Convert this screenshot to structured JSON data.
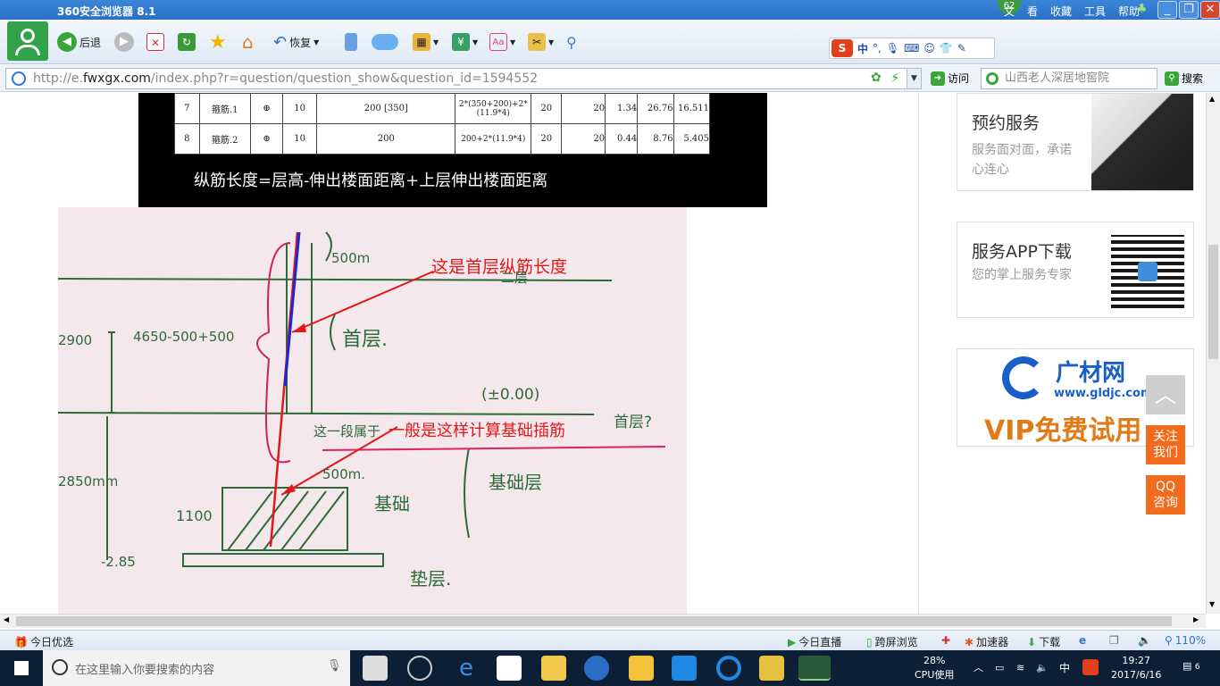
{
  "window": {
    "title": "360安全浏览器 8.1",
    "menu": [
      "文",
      "看",
      "收藏",
      "工具",
      "帮助"
    ],
    "badge": "62",
    "controls": [
      "_",
      "❐",
      "✕"
    ]
  },
  "toolbar": {
    "back_label": "后退",
    "restore_label": "恢复",
    "ime": {
      "logo": "S",
      "lang": "中"
    }
  },
  "address": {
    "url_prefix": "http://e.",
    "url_host": "fwxgx.com",
    "url_rest": "/index.php?r=question/question_show&question_id=1594552",
    "visit_label": "访问",
    "search_placeholder": "山西老人深居地窖院",
    "search_label": "搜索"
  },
  "table_image": {
    "rows": [
      {
        "no": "7",
        "name": "箍筋.1",
        "grade": "⊕",
        "dia": "10",
        "shape": "200 [350]",
        "formula": "2*(350+200)+2*(11.9*4)",
        "c1": "20",
        "c2": "20",
        "w": "1.34",
        "total": "26.76",
        "sum": "16.511"
      },
      {
        "no": "8",
        "name": "箍筋.2",
        "grade": "⊕",
        "dia": "10",
        "shape": "200",
        "formula": "200+2*(11.9*4)",
        "c1": "20",
        "c2": "20",
        "w": "0.44",
        "total": "8.76",
        "sum": "5.405"
      }
    ],
    "caption": "纵筋长度=层高-伸出楼面距离+上层伸出楼面距离"
  },
  "sketch": {
    "annotation_1": "这是首层纵筋长度",
    "annotation_2": "一般是这样计算基础插筋",
    "hand_labels": [
      "500m",
      "二层",
      "2900",
      "4650-500+500",
      "首层.",
      "(±0.00)",
      "这一段属于",
      "首层?",
      "2850mm",
      "500m.",
      "基础层",
      "1100",
      "基础",
      "-2.85",
      "垫层."
    ]
  },
  "sidebar": {
    "card1": {
      "title": "预约服务",
      "sub": "服务面对面，承诺心连心"
    },
    "card2": {
      "title": "服务APP下载",
      "sub": "您的掌上服务专家"
    },
    "card3": {
      "logo": "广材网",
      "domain": "www.gldjc.com",
      "promo": "VIP免费试用"
    },
    "float_top": "︿",
    "float_follow": "关注我们",
    "float_qq": "QQ咨询"
  },
  "status": {
    "today": "今日优选",
    "live": "今日直播",
    "cross": "跨屏浏览",
    "accel": "加速器",
    "download": "下载",
    "zoom": "110%"
  },
  "taskbar": {
    "search_placeholder": "在这里输入你要搜索的内容",
    "cpu_value": "28%",
    "cpu_label": "CPU使用",
    "ime": "中",
    "time": "19:27",
    "date": "2017/6/16",
    "notif": "6"
  }
}
